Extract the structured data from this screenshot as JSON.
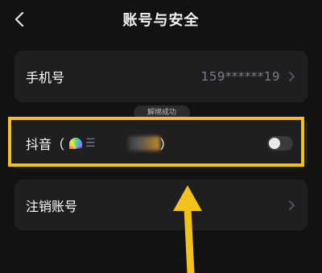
{
  "header": {
    "title": "账号与安全",
    "back_icon": "chevron-left-icon"
  },
  "rows": {
    "phone": {
      "label": "手机号",
      "value": "159******19",
      "icon": "chevron-right-icon"
    },
    "douyin": {
      "label": "抖音（",
      "suffix": "）",
      "toggle_on": false,
      "icon": "rainbow-avatar-icon"
    },
    "cancel": {
      "label": "注销账号",
      "icon": "chevron-right-icon"
    }
  },
  "toast": {
    "text": "解绑成功"
  },
  "annotation": {
    "highlight_color": "#f2c21b",
    "arrow_color": "#f2c21b"
  }
}
